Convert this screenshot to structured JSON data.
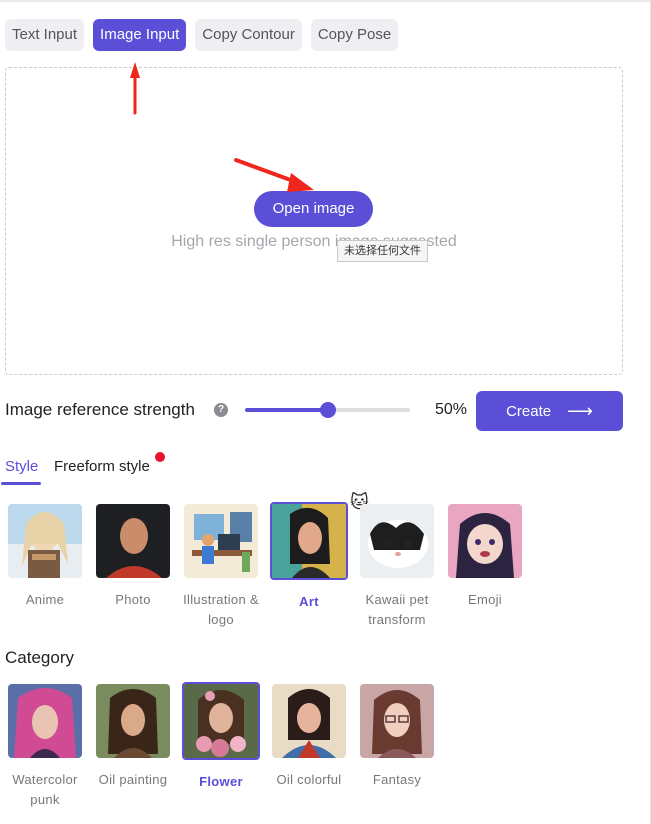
{
  "tabs": [
    "Text Input",
    "Image Input",
    "Copy Contour",
    "Copy Pose"
  ],
  "active_tab": 1,
  "upload": {
    "open_button": "Open image",
    "hint": "High res single person image suggested",
    "file_tooltip": "未选择任何文件"
  },
  "strength": {
    "label": "Image reference strength",
    "value": 50,
    "value_label": "50%"
  },
  "create_button": "Create",
  "style_tabs": [
    "Style",
    "Freeform style"
  ],
  "styles": [
    {
      "label": "Anime",
      "selected": false
    },
    {
      "label": "Photo",
      "selected": false
    },
    {
      "label": "Illustration & logo",
      "selected": false
    },
    {
      "label": "Art",
      "selected": true
    },
    {
      "label": "Kawaii pet transform",
      "selected": false
    },
    {
      "label": "Emoji",
      "selected": false
    }
  ],
  "category_title": "Category",
  "categories": [
    {
      "label": "Watercolor punk",
      "selected": false
    },
    {
      "label": "Oil painting",
      "selected": false
    },
    {
      "label": "Flower",
      "selected": true
    },
    {
      "label": "Oil colorful",
      "selected": false
    },
    {
      "label": "Fantasy",
      "selected": false
    }
  ],
  "colors": {
    "accent": "#5b4fd8",
    "dot": "#e8102a",
    "annotation_arrow": "#f0251b"
  }
}
